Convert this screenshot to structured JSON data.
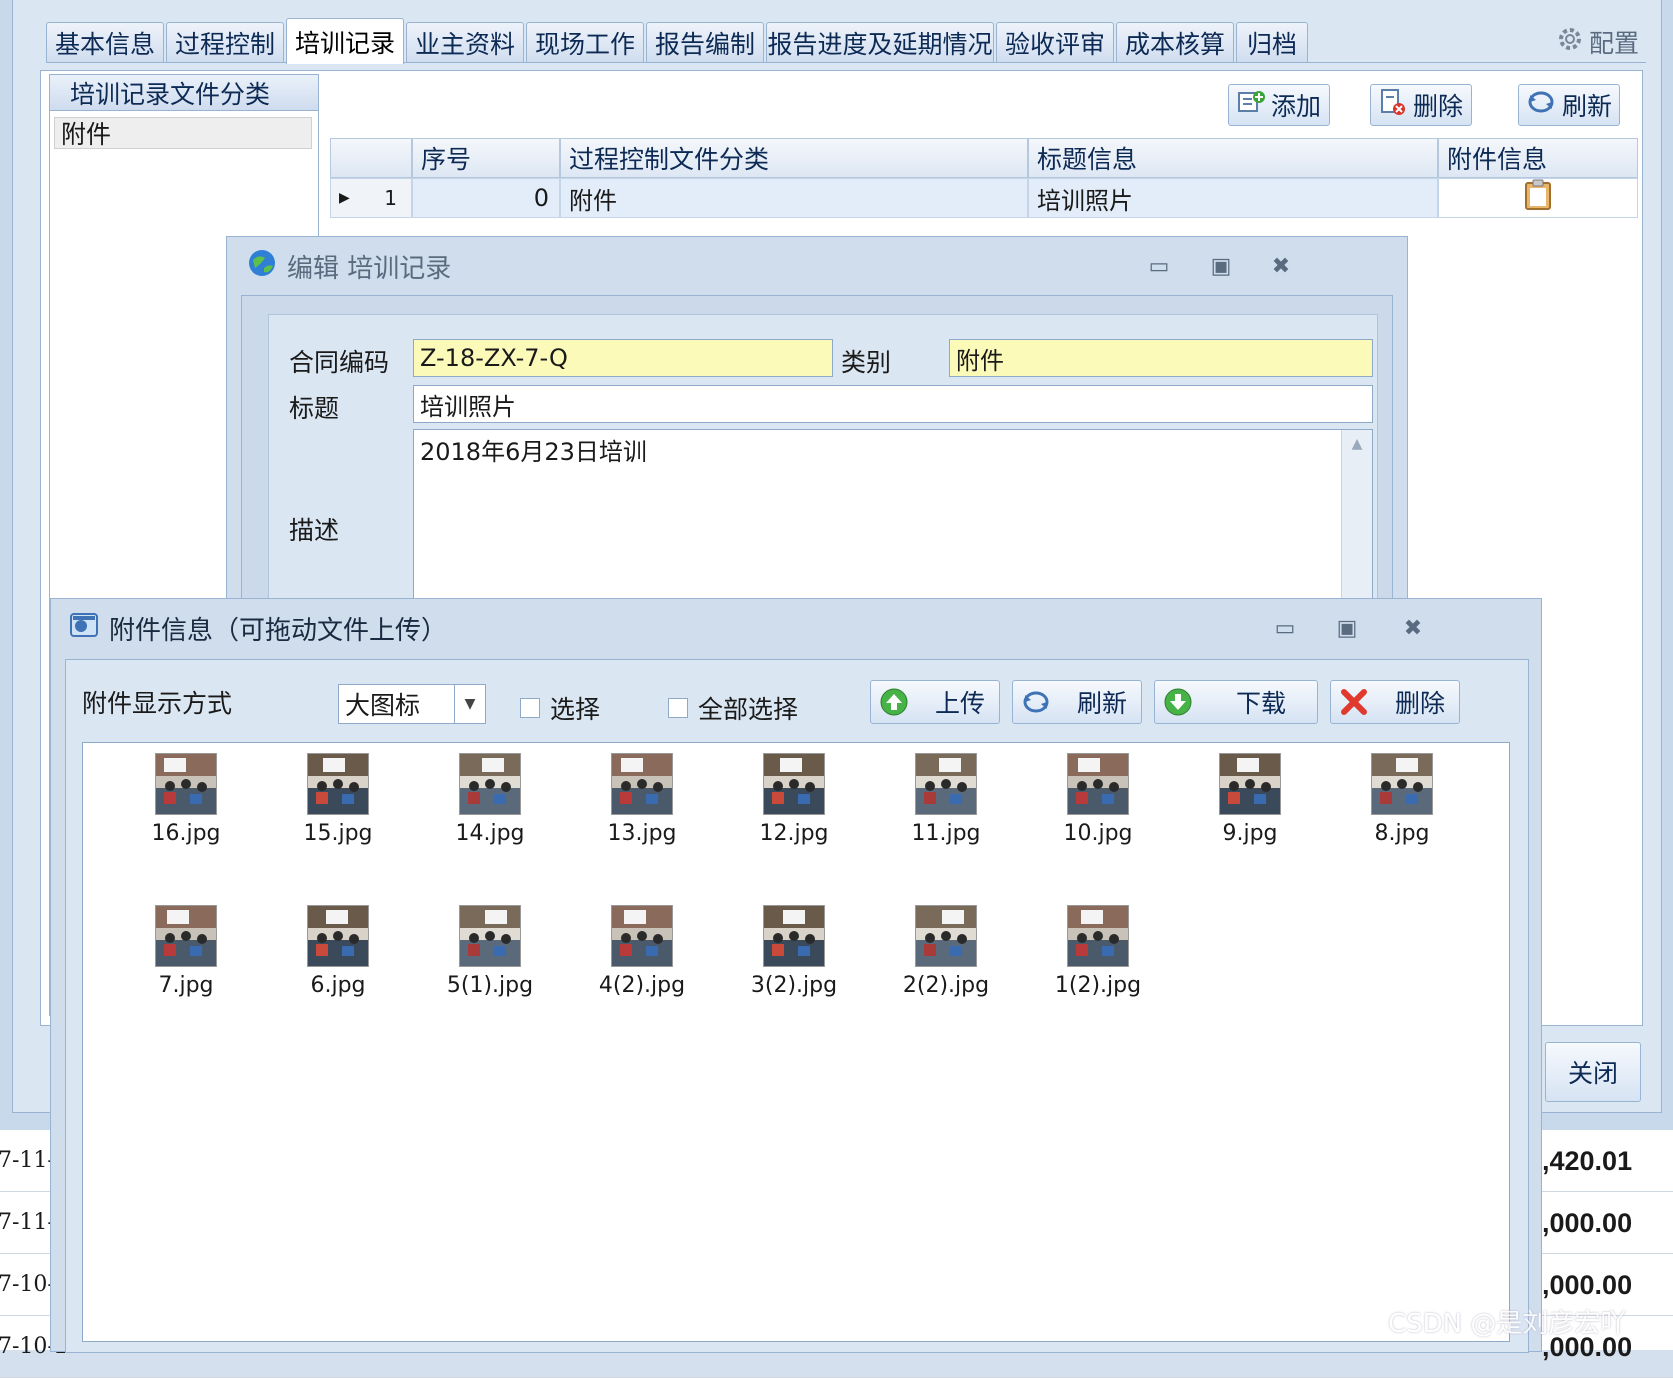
{
  "tabs": [
    "基本信息",
    "过程控制",
    "培训记录",
    "业主资料",
    "现场工作",
    "报告编制",
    "报告进度及延期情况",
    "验收评审",
    "成本核算",
    "归档"
  ],
  "active_tab": 2,
  "config_label": "配置",
  "category_panel": {
    "title": "培训记录文件分类",
    "items": [
      "附件"
    ]
  },
  "toolbar": {
    "add": "添加",
    "delete": "删除",
    "refresh": "刷新"
  },
  "grid": {
    "columns": [
      "序号",
      "过程控制文件分类",
      "标题信息",
      "附件信息"
    ],
    "rows": [
      {
        "row_no": "1",
        "seq": "0",
        "category": "附件",
        "title": "培训照片"
      }
    ]
  },
  "edit_dialog": {
    "title": "编辑 培训记录",
    "contract_label": "合同编码",
    "contract_value": "Z-18-ZX-7-Q",
    "type_label": "类别",
    "type_value": "附件",
    "subject_label": "标题",
    "subject_value": "培训照片",
    "desc_label": "描述",
    "desc_value": "2018年6月23日培训"
  },
  "attach_dialog": {
    "title": "附件信息（可拖动文件上传）",
    "mode_label": "附件显示方式",
    "mode_value": "大图标",
    "select_label": "选择",
    "select_all_label": "全部选择",
    "upload": "上传",
    "refresh": "刷新",
    "download": "下载",
    "delete": "删除",
    "files": [
      "16.jpg",
      "15.jpg",
      "14.jpg",
      "13.jpg",
      "12.jpg",
      "11.jpg",
      "10.jpg",
      "9.jpg",
      "8.jpg",
      "7.jpg",
      "6.jpg",
      "5(1).jpg",
      "4(2).jpg",
      "3(2).jpg",
      "2(2).jpg",
      "1(2).jpg"
    ]
  },
  "close_label": "关闭",
  "background_grid": {
    "left": [
      "7-11-(",
      "7-11-(",
      "7-10-2",
      "7-10-2"
    ],
    "right": [
      ",420.01",
      ",000.00",
      ",000.00",
      ",000.00"
    ]
  },
  "watermark": "CSDN @是刘彦宏吖",
  "colors": {
    "accent": "#99b4d3",
    "panel_bg": "#dbe6f3",
    "required_field": "#fbfab9",
    "selected_row": "#e3edf9"
  }
}
